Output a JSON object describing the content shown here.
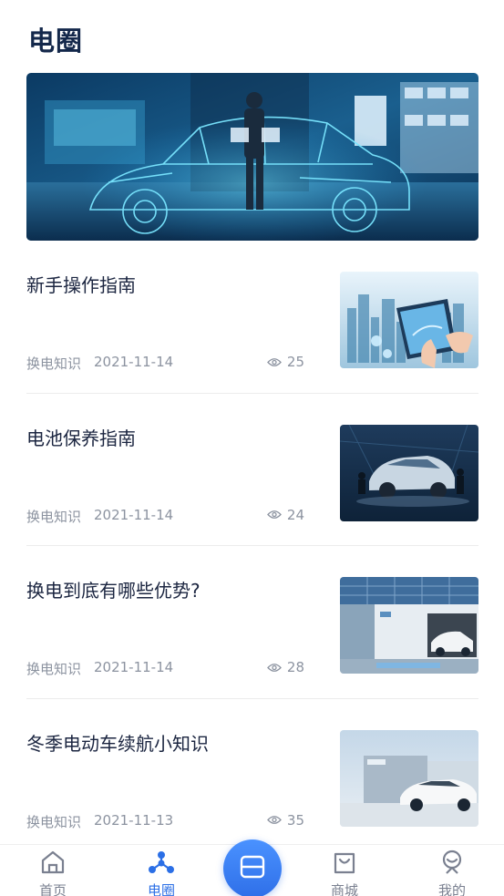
{
  "header": {
    "title": "电圈"
  },
  "articles": [
    {
      "title": "新手操作指南",
      "category": "换电知识",
      "date": "2021-11-14",
      "views": "25"
    },
    {
      "title": "电池保养指南",
      "category": "换电知识",
      "date": "2021-11-14",
      "views": "24"
    },
    {
      "title": "换电到底有哪些优势?",
      "category": "换电知识",
      "date": "2021-11-14",
      "views": "28"
    },
    {
      "title": "冬季电动车续航小知识",
      "category": "换电知识",
      "date": "2021-11-13",
      "views": "35"
    }
  ],
  "tabbar": {
    "items": [
      {
        "label": "首页",
        "icon": "home-icon"
      },
      {
        "label": "电圈",
        "icon": "community-icon",
        "active": true
      },
      {
        "label": "",
        "icon": "scan-icon"
      },
      {
        "label": "商城",
        "icon": "shopping-bag-icon"
      },
      {
        "label": "我的",
        "icon": "profile-icon"
      }
    ]
  },
  "colors": {
    "accent": "#2b6fe6",
    "title": "#14284b",
    "meta": "#8c93a0"
  }
}
